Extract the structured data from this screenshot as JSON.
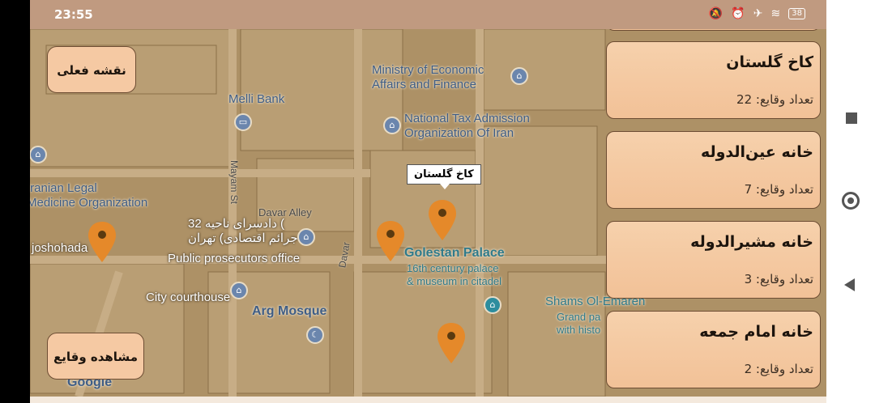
{
  "status_bar": {
    "time": "23:55",
    "icons": [
      "mute-bell-icon",
      "alarm-icon",
      "airplane-icon",
      "wifi-icon",
      "battery-icon"
    ],
    "battery": "38"
  },
  "map": {
    "labels": {
      "ministry": "Ministry of Economic\nAffairs and Finance",
      "melli_bank": "Melli Bank",
      "tax": "National Tax Admission\nOrganization Of Iran",
      "legal_medicine": "Iranian Legal\nMedicine Organization",
      "davar_alley": "Davar Alley",
      "prosecutor_fa": "دادسرای ناحیه 32 (\nجرائم اقتصادی) تهران",
      "prosecutor_en": "Public prosecutors office",
      "golestan": "Golestan Palace",
      "golestan_sub": "16th century palace\n& museum in citadel",
      "city_courthouse": "City courthouse",
      "arg_mosque": "Arg Mosque",
      "shams": "Shams Ol-Emareh",
      "shams_sub": "Grand pa\nwith histo",
      "shohada": "joshohada",
      "mayam": "Mayam St",
      "davar": "Davar",
      "google": "Google"
    },
    "tooltip": "کاخ گلستان",
    "pin_color": "#e5892a"
  },
  "buttons": {
    "current_map": "نقشه فعلی",
    "view_events": "مشاهده وقایع"
  },
  "places": [
    {
      "name": "کاخ گلستان",
      "count": "تعداد وقایع: 22"
    },
    {
      "name": "خانه عین‌الدوله",
      "count": "تعداد وقایع: 7"
    },
    {
      "name": "خانه مشیرالدوله",
      "count": "تعداد وقایع: 3"
    },
    {
      "name": "خانه امام جمعه",
      "count": "تعداد وقایع: 2"
    }
  ],
  "nav": [
    "recents-icon",
    "home-icon",
    "back-icon"
  ]
}
